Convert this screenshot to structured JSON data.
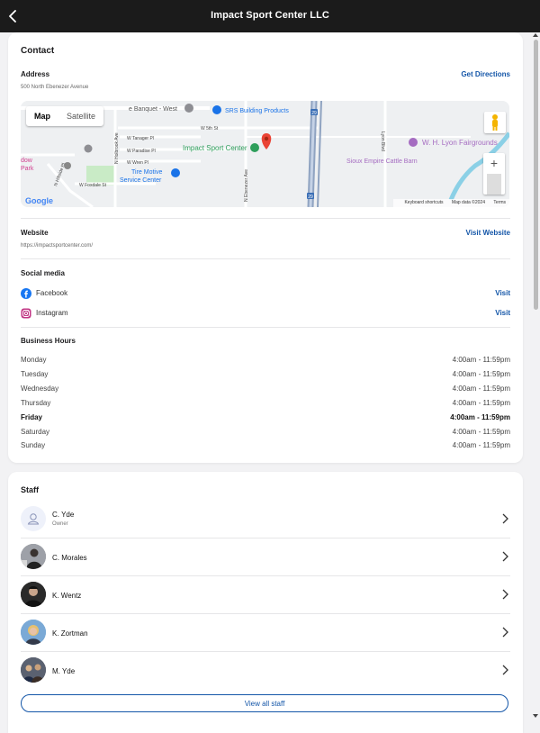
{
  "header": {
    "title": "Impact Sport Center LLC"
  },
  "contact": {
    "title": "Contact",
    "address_label": "Address",
    "address": "500 North Ebenezer Avenue",
    "directions_link": "Get Directions",
    "website_label": "Website",
    "website_url": "https://impactsportcenter.com/",
    "website_link": "Visit Website",
    "social_label": "Social media",
    "social": [
      {
        "name": "Facebook",
        "action": "Visit",
        "icon": "facebook-icon",
        "color": "#1877f2"
      },
      {
        "name": "Instagram",
        "action": "Visit",
        "icon": "instagram-icon",
        "color": "#c13584"
      }
    ],
    "hours_label": "Business Hours",
    "hours": [
      {
        "day": "Monday",
        "time": "4:00am - 11:59pm",
        "current": false
      },
      {
        "day": "Tuesday",
        "time": "4:00am - 11:59pm",
        "current": false
      },
      {
        "day": "Wednesday",
        "time": "4:00am - 11:59pm",
        "current": false
      },
      {
        "day": "Thursday",
        "time": "4:00am - 11:59pm",
        "current": false
      },
      {
        "day": "Friday",
        "time": "4:00am - 11:59pm",
        "current": true
      },
      {
        "day": "Saturday",
        "time": "4:00am - 11:59pm",
        "current": false
      },
      {
        "day": "Sunday",
        "time": "4:00am - 11:59pm",
        "current": false
      }
    ]
  },
  "map": {
    "tab_map": "Map",
    "tab_satellite": "Satellite",
    "labels": {
      "banquet": "e Banquet - West",
      "srs": "SRS Building Products",
      "w5th": "W 5th St",
      "tanager": "W Tanager Pl",
      "paradise": "W Paradise Pl",
      "wren": "W Wren Pl",
      "foxdale": "W Foxdale St",
      "holbrook": "N Holbrook Ave",
      "hillside": "N Hillside Pl",
      "ebenezer": "N Ebenezer Ave",
      "lyon_blvd": "Lyon Blvd",
      "impact": "Impact Sport Center",
      "tire1": "Tire Motive",
      "tire2": "Service Center",
      "fairgrounds": "W. H. Lyon Fairgrounds",
      "cattle": "Sioux Empire Cattle Barn",
      "park1": "dow",
      "park2": "Park",
      "shield1": "29",
      "shield2": "29",
      "google": "Google",
      "keyboard": "Keyboard shortcuts",
      "mapdata": "Map data ©2024",
      "terms": "Terms"
    },
    "zoom_in": "+",
    "zoom_out": "−"
  },
  "staff": {
    "title": "Staff",
    "members": [
      {
        "name": "C. Yde",
        "role": "Owner"
      },
      {
        "name": "C. Morales",
        "role": ""
      },
      {
        "name": "K. Wentz",
        "role": ""
      },
      {
        "name": "K. Zortman",
        "role": ""
      },
      {
        "name": "M. Yde",
        "role": ""
      }
    ],
    "view_all": "View all staff"
  },
  "colors": {
    "accent": "#1456a8",
    "header_bg": "#1b1b1b",
    "pin": "#ea4335"
  }
}
